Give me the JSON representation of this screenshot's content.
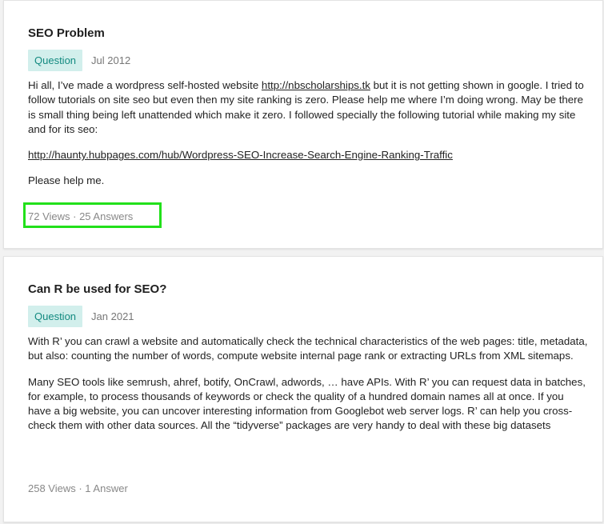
{
  "posts": [
    {
      "title": "SEO Problem",
      "badge": "Question",
      "date": "Jul 2012",
      "body": {
        "p1_before_link": "Hi all, I’ve made a wordpress self-hosted website ",
        "p1_link": "http://nbscholarships.tk",
        "p1_after_link": " but it is not getting shown in google. I tried to follow tutorials on site seo but even then my site ranking is zero. Please help me where I’m doing wrong. May be there is small thing being left unattended which make it zero. I followed specially the following tutorial while making my site and for its seo:",
        "p2_link": "http://haunty.hubpages.com/hub/Wordpress-SEO-Increase-Search-Engine-Ranking-Traffic",
        "p3": "Please help me."
      },
      "stats": "72 Views · 25 Answers"
    },
    {
      "title": "Can R be used for SEO?",
      "badge": "Question",
      "date": "Jan 2021",
      "body": {
        "p1": "With R’ you can crawl a website and automatically check the technical characteristics of the web pages: title, metadata, but also: counting the number of words, compute website internal page rank or extracting URLs from XML sitemaps.",
        "p2": "Many SEO tools like semrush, ahref, botify, OnCrawl, adwords, … have APIs. With R’ you can request data in batches, for example, to process thousands of keywords or check the quality of a hundred domain names all at once. If you have a big website, you can uncover interesting information from Googlebot web server logs. R’ can help you cross-check them with other data sources. All the “tidyverse” packages are very handy to deal with these big datasets"
      },
      "stats": "258 Views · 1 Answer"
    }
  ],
  "colors": {
    "badge_bg": "#d2efec",
    "badge_text": "#138a80",
    "highlight_border": "#22e01a"
  }
}
